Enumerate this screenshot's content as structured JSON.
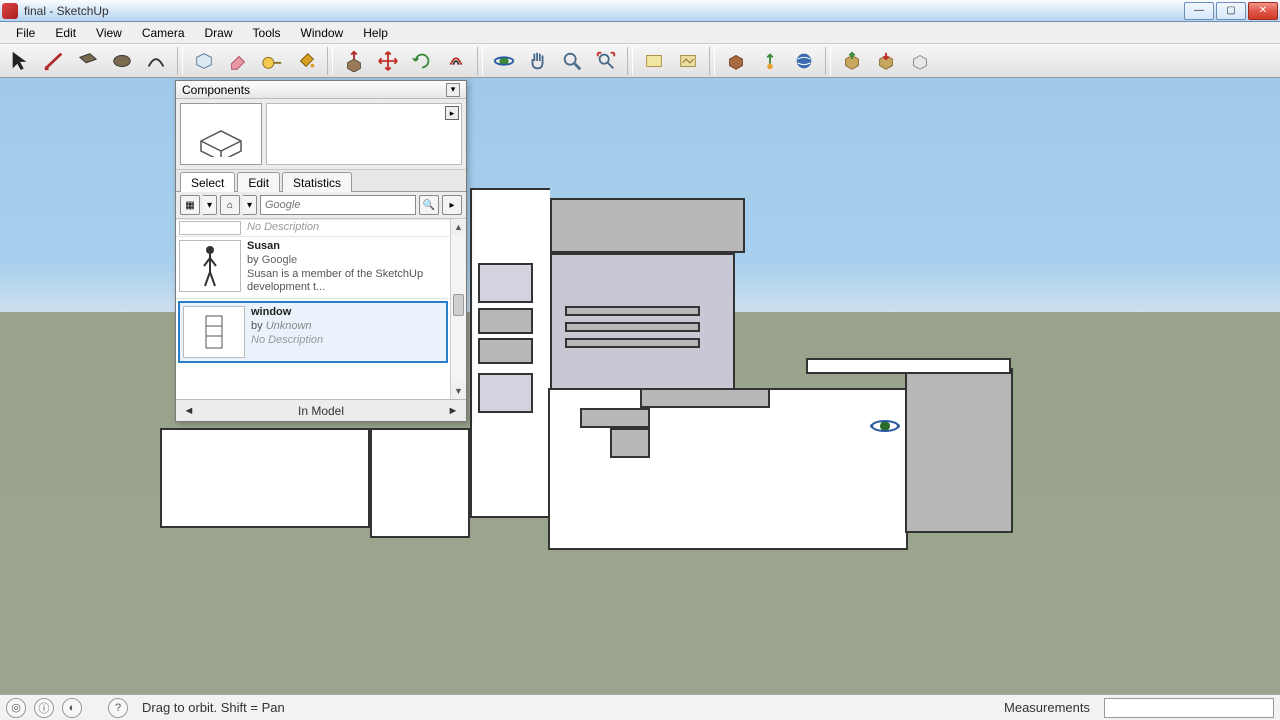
{
  "titlebar": {
    "title": "final - SketchUp"
  },
  "menu": {
    "items": [
      "File",
      "Edit",
      "View",
      "Camera",
      "Draw",
      "Tools",
      "Window",
      "Help"
    ]
  },
  "toolbar": {
    "tools": [
      "select",
      "line",
      "rectangle",
      "circle",
      "arc",
      "make-component",
      "eraser",
      "tape-measure",
      "paint-bucket",
      "push-pull",
      "move",
      "rotate",
      "offset",
      "orbit",
      "pan",
      "zoom",
      "zoom-extents",
      "add-location",
      "toggle-terrain",
      "get-models",
      "share-model",
      "preview-ge",
      "export",
      "import",
      "print"
    ]
  },
  "panel": {
    "title": "Components",
    "tabs": {
      "select": "Select",
      "edit": "Edit",
      "statistics": "Statistics",
      "active": "select"
    },
    "search_placeholder": "Google",
    "items": [
      {
        "name": "",
        "by_label": "",
        "author": "",
        "desc": "No Description",
        "desc_none": true,
        "partial": true
      },
      {
        "name": "Susan",
        "by_label": "by ",
        "author": "Google",
        "author_unknown": false,
        "desc": "Susan is a member of the SketchUp development t...",
        "desc_none": false
      },
      {
        "name": "window",
        "by_label": "by ",
        "author": "Unknown",
        "author_unknown": true,
        "desc": "No Description",
        "desc_none": true,
        "selected": true
      }
    ],
    "footer_label": "In Model"
  },
  "statusbar": {
    "hint": "Drag to orbit.  Shift = Pan",
    "measurements_label": "Measurements"
  }
}
